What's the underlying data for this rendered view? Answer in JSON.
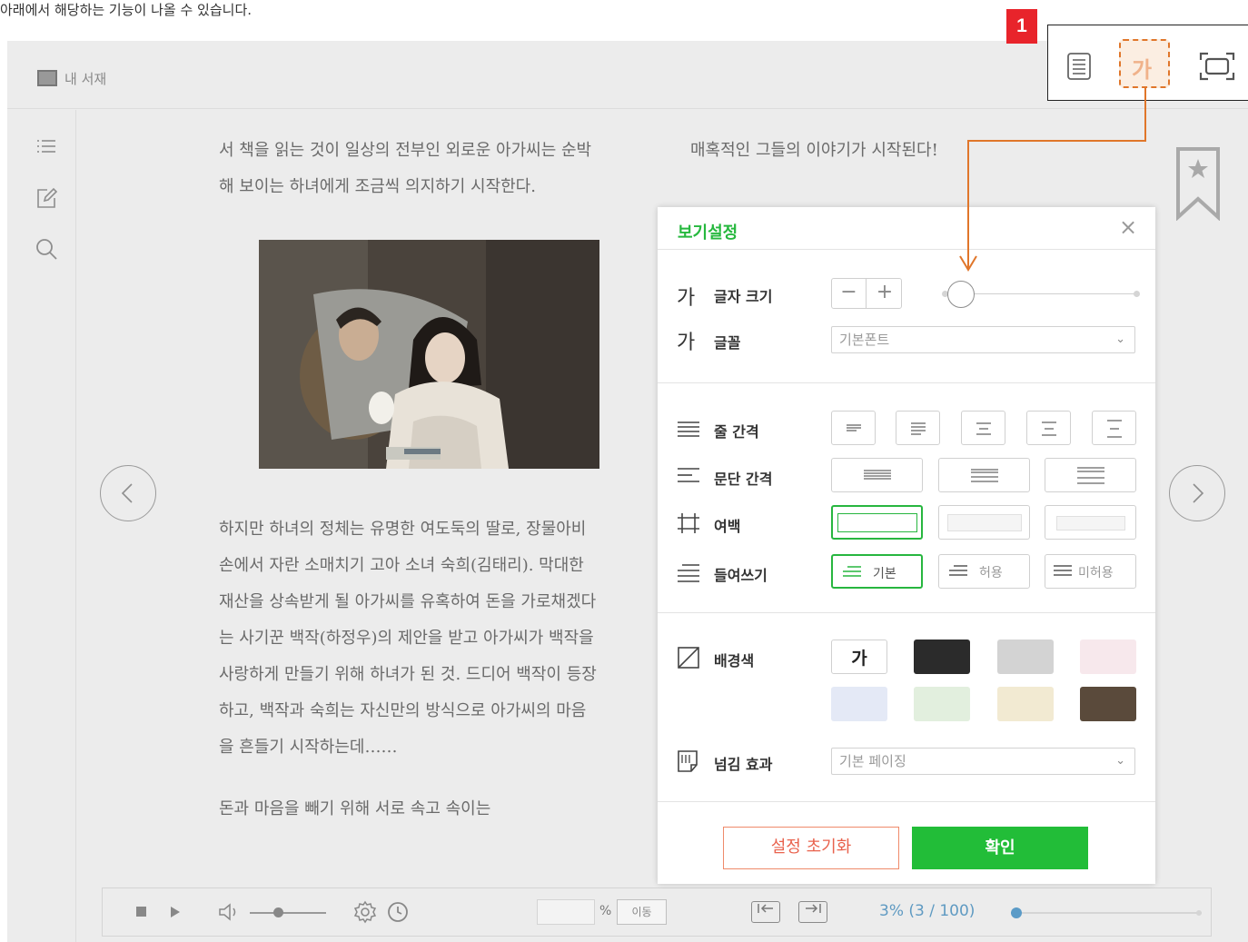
{
  "caption": "아래에서 해당하는 기능이 나올 수 있습니다.",
  "header": {
    "library_label": "내 서재"
  },
  "book": {
    "lines_top": [
      "서 책을 읽는 것이 일상의 전부인 외로운 아가씨는 순박",
      "해 보이는 하녀에게 조금씩 의지하기 시작한다."
    ],
    "right_col_line": "매혹적인 그들의 이야기가 시작된다!",
    "lines_bottom": [
      "하지만 하녀의 정체는 유명한 여도둑의 딸로, 장물아비",
      "손에서 자란 소매치기 고아 소녀 숙희(김태리). 막대한",
      "재산을 상속받게 될 아가씨를 유혹하여 돈을 가로채겠다",
      "는 사기꾼 백작(하정우)의 제안을 받고 아가씨가 백작을",
      "사랑하게 만들기 위해 하녀가 된 것. 드디어 백작이 등장",
      "하고, 백작과 숙희는 자신만의 방식으로 아가씨의 마음",
      "을 흔들기 시작하는데……"
    ],
    "last_line": "돈과 마음을 빼기 위해 서로 속고 속이는"
  },
  "toolbar": {
    "badge": "1",
    "font_icon_label": "가"
  },
  "dialog": {
    "title": "보기설정",
    "close": "×",
    "font_size": {
      "icon": "가",
      "label": "글자 크기",
      "minus": "−",
      "plus": "+",
      "level": 0.1
    },
    "font": {
      "icon": "가",
      "label": "글꼴",
      "value": "기본폰트"
    },
    "line_spacing": {
      "label": "줄 간격"
    },
    "paragraph_spacing": {
      "label": "문단 간격"
    },
    "margin": {
      "label": "여백"
    },
    "indent": {
      "label": "들여쓰기",
      "options": [
        "기본",
        "허용",
        "미허용"
      ]
    },
    "background": {
      "label": "배경색",
      "first_label": "가",
      "colors": [
        "#ffffff",
        "#2b2b2b",
        "#d3d3d3",
        "#f7e8ec",
        "#e4e9f6",
        "#e2efde",
        "#f2ead2",
        "#5a4a3b"
      ]
    },
    "page_effect": {
      "label": "넘김 효과",
      "value": "기본 페이징"
    },
    "reset_label": "설정 초기화",
    "ok_label": "확인"
  },
  "bottom_bar": {
    "percent_sign": "%",
    "move_label": "이동",
    "progress": "3% (3 / 100)",
    "progress_fraction": 0.03
  },
  "colors": {
    "accent_green": "#26b83e",
    "callout_orange": "#e0762a",
    "badge_red": "#e8242b",
    "progress_blue": "#3c86b8"
  }
}
